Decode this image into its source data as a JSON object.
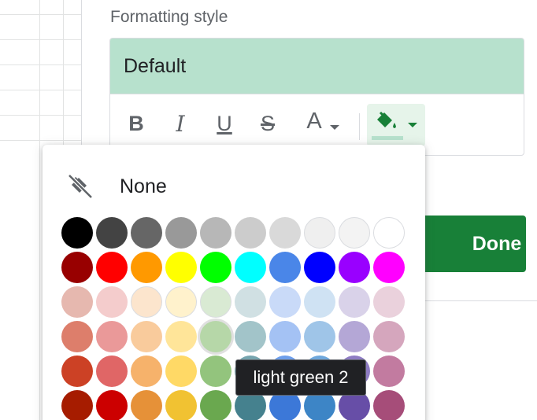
{
  "panel": {
    "formatting_style_label": "Formatting style",
    "preview_text": "Default",
    "preview_bg_color": "#b7e1cd",
    "toolbar": {
      "bold_label": "B",
      "italic_label": "I",
      "underline_label": "U",
      "strikethrough_label": "S",
      "text_color_label": "A",
      "fill_icon": "paint-bucket-icon",
      "fill_color": "#188038"
    },
    "done_label": "Done"
  },
  "picker": {
    "none_label": "None",
    "none_icon": "fill-none-icon",
    "rows": [
      [
        "#000000",
        "#434343",
        "#666666",
        "#999999",
        "#b7b7b7",
        "#cccccc",
        "#d9d9d9",
        "#efefef",
        "#f3f3f3",
        "#ffffff"
      ],
      [
        "#980000",
        "#ff0000",
        "#ff9900",
        "#ffff00",
        "#00ff00",
        "#00ffff",
        "#4a86e8",
        "#0000ff",
        "#9900ff",
        "#ff00ff"
      ],
      [
        "#e6b8af",
        "#f4cccc",
        "#fce5cd",
        "#fff2cc",
        "#d9ead3",
        "#d0e0e3",
        "#c9daf8",
        "#cfe2f3",
        "#d9d2e9",
        "#ead1dc"
      ],
      [
        "#dd7e6b",
        "#ea9999",
        "#f9cb9c",
        "#ffe599",
        "#b6d7a8",
        "#a2c4c9",
        "#a4c2f4",
        "#9fc5e8",
        "#b4a7d6",
        "#d5a6bd"
      ],
      [
        "#cc4125",
        "#e06666",
        "#f6b26b",
        "#ffd966",
        "#93c47d",
        "#76a5af",
        "#6d9eeb",
        "#6fa8dc",
        "#8e7cc3",
        "#c27ba0"
      ],
      [
        "#a61c00",
        "#cc0000",
        "#e69138",
        "#f1c232",
        "#6aa84f",
        "#45818e",
        "#3c78d8",
        "#3d85c6",
        "#674ea7",
        "#a64d79"
      ]
    ],
    "hovered_swatch": "light green 2",
    "tooltip_text": "light green 2"
  }
}
